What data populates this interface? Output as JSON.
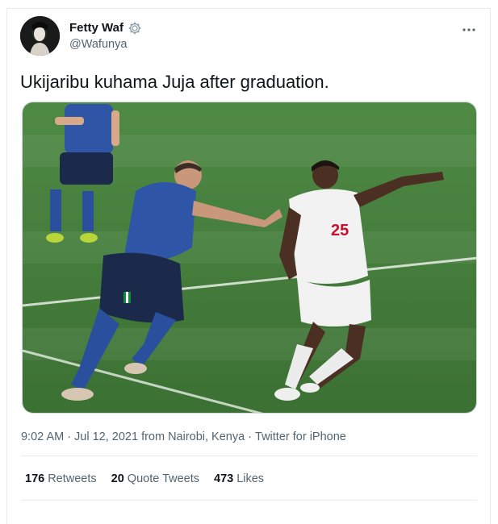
{
  "tweet": {
    "author_name": "Fetty Waf",
    "author_handle": "@Wafunya",
    "text": "Ukijaribu kuhama Juja after graduation.",
    "more_icon": "more-horizontal-icon",
    "verified_icon": "verified-badge-icon"
  },
  "meta": {
    "time": "9:02 AM",
    "date": "Jul 12, 2021",
    "location_prefix": "from",
    "location": "Nairobi, Kenya",
    "client": "Twitter for iPhone",
    "separator": "·"
  },
  "stats": {
    "retweets_count": "176",
    "retweets_label": "Retweets",
    "quote_count": "20",
    "quote_label": "Quote Tweets",
    "likes_count": "473",
    "likes_label": "Likes"
  },
  "colors": {
    "pitch_green": "#3f7a3c",
    "italy_blue": "#2f56a6",
    "england_white": "#f2f2f2",
    "england_number_red": "#c8102e"
  }
}
